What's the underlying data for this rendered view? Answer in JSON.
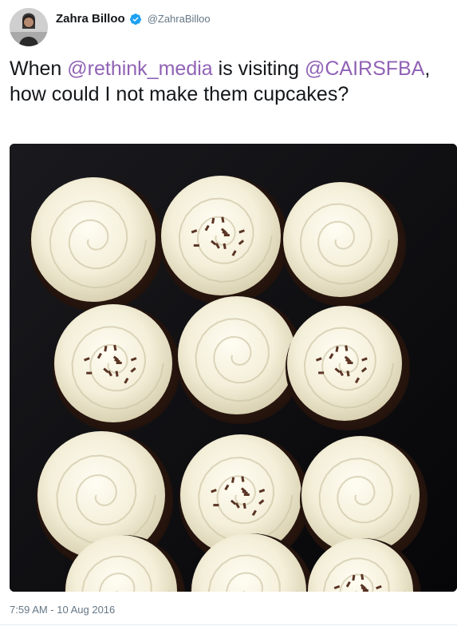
{
  "author": {
    "display_name": "Zahra Billoo",
    "handle": "@ZahraBilloo",
    "verified": true,
    "avatar_icon": "profile-avatar"
  },
  "tweet": {
    "text_before": "When ",
    "mention1": "@rethink_media",
    "text_middle": " is visiting ",
    "mention2": "@CAIRSFBA",
    "text_after": ", how could I not make them cupcakes?",
    "timestamp": "7:59 AM - 10 Aug 2016"
  },
  "media": {
    "description_icon": "cupcakes-photo"
  },
  "colors": {
    "mention": "#9062b5",
    "verified": "#1da1f2",
    "muted": "#657786"
  }
}
